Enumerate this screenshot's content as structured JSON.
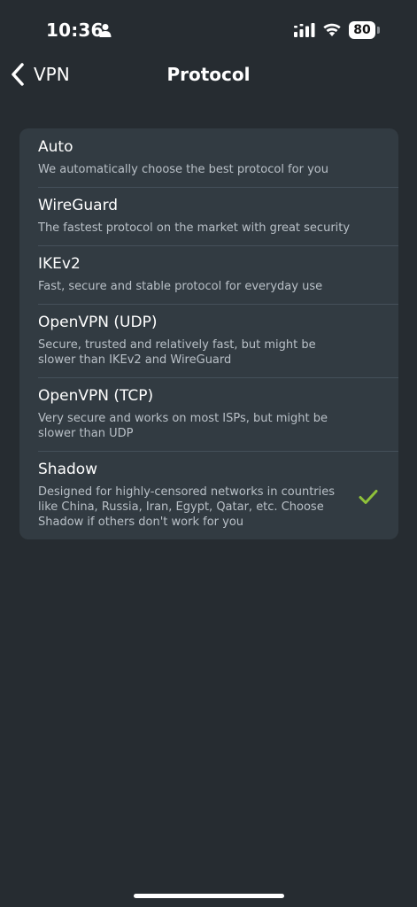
{
  "status_bar": {
    "time": "10:36",
    "battery": "80",
    "icons": [
      "person-icon",
      "cellular-signal-icon",
      "wifi-icon",
      "battery-icon"
    ]
  },
  "nav": {
    "back_label": "VPN",
    "title": "Protocol",
    "back_icon": "chevron-left-icon"
  },
  "protocols": [
    {
      "title": "Auto",
      "description": "We automatically choose the best protocol for you",
      "selected": false
    },
    {
      "title": "WireGuard",
      "description": "The fastest protocol on the market with great security",
      "selected": false
    },
    {
      "title": "IKEv2",
      "description": "Fast, secure and stable protocol for everyday use",
      "selected": false
    },
    {
      "title": "OpenVPN (UDP)",
      "description": "Secure, trusted and relatively fast, but might be slower than IKEv2 and WireGuard",
      "selected": false
    },
    {
      "title": "OpenVPN (TCP)",
      "description": "Very secure and works on most ISPs, but might be slower than UDP",
      "selected": false
    },
    {
      "title": "Shadow",
      "description": "Designed for highly-censored networks in countries like China, Russia, Iran, Egypt, Qatar, etc. Choose Shadow if others don't work for you",
      "selected": true
    }
  ],
  "colors": {
    "background": "#262c31",
    "card": "#323b42",
    "accent_check": "#8fc13a"
  }
}
